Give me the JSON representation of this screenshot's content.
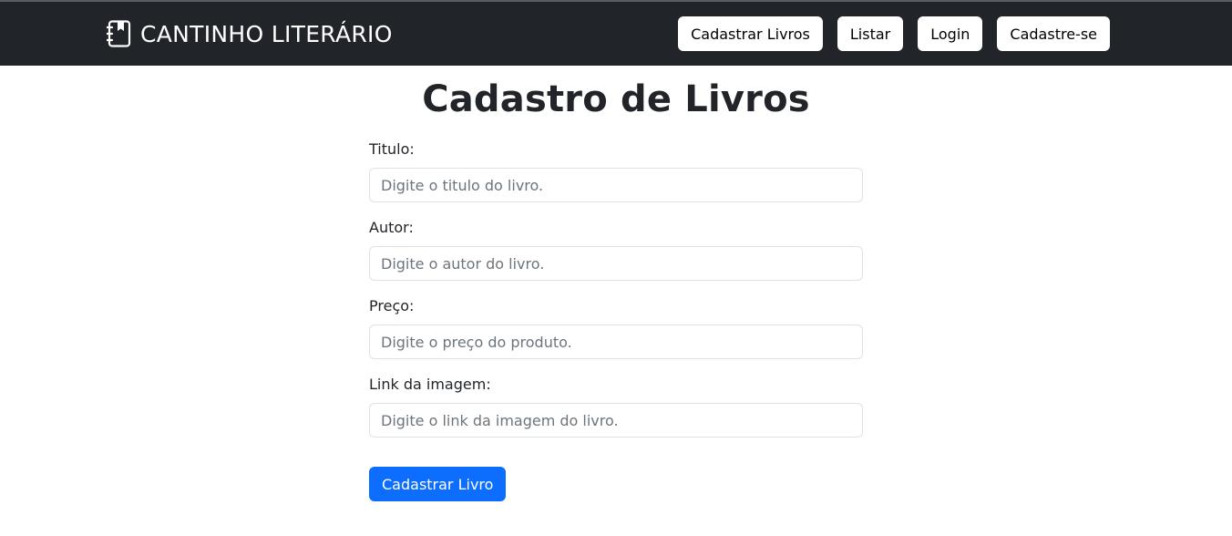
{
  "navbar": {
    "brand_icon": "book-icon",
    "brand_text": "CANTINHO LITERÁRIO",
    "buttons": [
      {
        "label": "Cadastrar Livros"
      },
      {
        "label": "Listar"
      },
      {
        "label": "Login"
      },
      {
        "label": "Cadastre-se"
      }
    ]
  },
  "page": {
    "title": "Cadastro de Livros"
  },
  "form": {
    "fields": [
      {
        "label": "Titulo:",
        "placeholder": "Digite o titulo do livro.",
        "value": ""
      },
      {
        "label": "Autor:",
        "placeholder": "Digite o autor do livro.",
        "value": ""
      },
      {
        "label": "Preço:",
        "placeholder": "Digite o preço do produto.",
        "value": ""
      },
      {
        "label": "Link da imagem:",
        "placeholder": "Digite o link da imagem do livro.",
        "value": ""
      }
    ],
    "submit_label": "Cadastrar Livro"
  },
  "colors": {
    "navbar_bg": "#212529",
    "primary": "#0d6efd",
    "text": "#212529",
    "placeholder": "#6c757d",
    "border": "#dee2e6"
  }
}
